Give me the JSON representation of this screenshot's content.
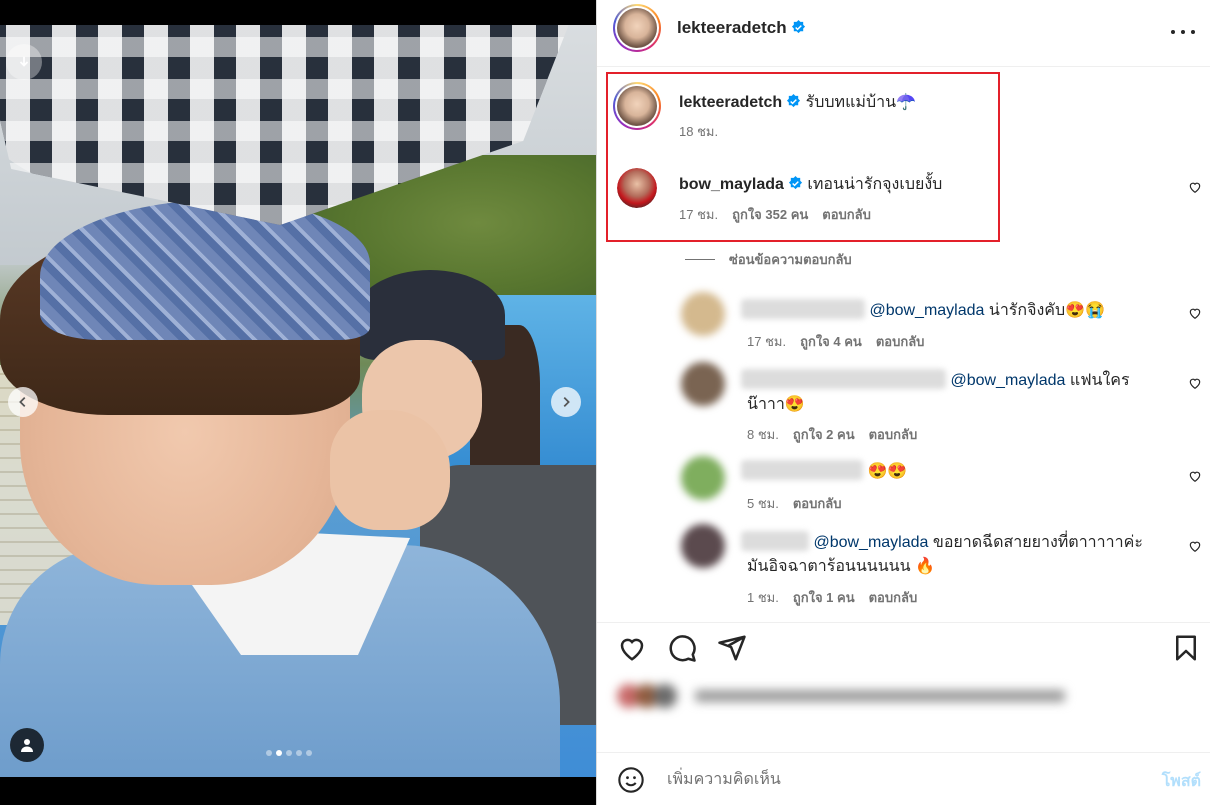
{
  "post_author": {
    "username": "lekteeradetch",
    "verified": true
  },
  "caption": {
    "username": "lekteeradetch",
    "text": "รับบทแม่บ้าน☂️",
    "time": "18 ชม."
  },
  "highlighted_comment": {
    "username": "bow_maylada",
    "text": "เทอนน่ารักจุงเบยงั้บ",
    "time": "17 ชม.",
    "likes": "ถูกใจ 352 คน",
    "reply": "ตอบกลับ"
  },
  "hide_replies": "ซ่อนข้อความตอบกลับ",
  "replies": [
    {
      "mention": "@bow_maylada",
      "text": "น่ารักจิงคับ😍😭",
      "time": "17 ชม.",
      "likes": "ถูกใจ 4 คน",
      "reply": "ตอบกลับ"
    },
    {
      "mention": "@bow_maylada",
      "text": "แฟนใคร",
      "text2": "น๊าาา😍",
      "time": "8 ชม.",
      "likes": "ถูกใจ 2 คน",
      "reply": "ตอบกลับ"
    },
    {
      "mention": "",
      "text": "😍😍",
      "time": "5 ชม.",
      "likes": "",
      "reply": "ตอบกลับ"
    },
    {
      "mention": "@bow_maylada",
      "text": "ขอยาดฉีดสายยางที่ตาาาาาค่ะ",
      "text2": "มันอิจฉาตาร้อนนนนนน 🔥",
      "time": "1 ชม.",
      "likes": "ถูกใจ 1 คน",
      "reply": "ตอบกลับ"
    }
  ],
  "comment_bar": {
    "placeholder": "เพิ่มความคิดเห็น",
    "post_label": "โพสต์"
  },
  "carousel": {
    "total": 5,
    "active": 2
  },
  "colors": {
    "highlight_border": "#e3202a",
    "verified": "#0095f6",
    "mention": "#00376b"
  }
}
